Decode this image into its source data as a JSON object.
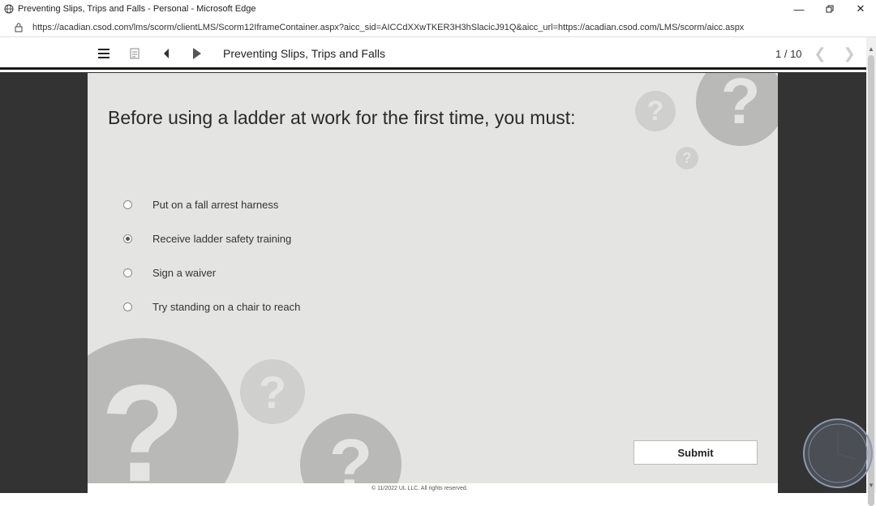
{
  "browser": {
    "title": "Preventing Slips, Trips and Falls - Personal - Microsoft Edge",
    "url": "https://acadian.csod.com/lms/scorm/clientLMS/Scorm12IframeContainer.aspx?aicc_sid=AICCdXXwTKER3H3hSlacicJ91Q&aicc_url=https://acadian.csod.com/LMS/scorm/aicc.aspx",
    "icons": [
      "globe-icon",
      "minimize-icon",
      "restore-icon",
      "close-icon",
      "lock-icon"
    ]
  },
  "toolbar": {
    "course_title": "Preventing Slips, Trips and Falls",
    "page_count": "1 / 10",
    "icons": [
      "menu-icon",
      "notes-icon",
      "previous-icon",
      "play-icon",
      "chevron-left-icon",
      "chevron-right-icon"
    ]
  },
  "slide": {
    "question": "Before using a ladder at work for the first time, you must:",
    "options": [
      {
        "label": "Put on a fall arrest harness",
        "selected": false
      },
      {
        "label": "Receive ladder safety training",
        "selected": true
      },
      {
        "label": "Sign a waiver",
        "selected": false
      },
      {
        "label": "Try standing on a chair to reach",
        "selected": false
      }
    ],
    "submit_label": "Submit",
    "copyright": "© 11/2022 UL LLC. All rights reserved.",
    "decor_glyph": "?"
  },
  "colors": {
    "slide_background": "#e4e4e2",
    "stage_background": "#333333",
    "decor_circle": "#b9b9b8"
  }
}
